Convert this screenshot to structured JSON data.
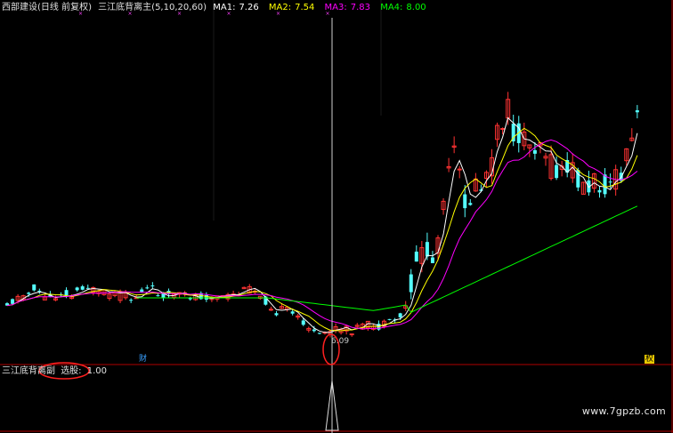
{
  "header": {
    "stock_title": "西部建设(日线 前复权)",
    "indicator_title": "三江底背离主(5,10,20,60)",
    "ma": [
      {
        "label": "MA1:",
        "value": "7.26",
        "color": "#ffffff"
      },
      {
        "label": "MA2:",
        "value": "7.54",
        "color": "#ffff00"
      },
      {
        "label": "MA3:",
        "value": "7.83",
        "color": "#ff00ff"
      },
      {
        "label": "MA4:",
        "value": "8.00",
        "color": "#00ff00"
      }
    ]
  },
  "price_annotation": "6.09",
  "markers": {
    "cai": "财",
    "quan": "权"
  },
  "sub_panel": {
    "title": "三江底背离副",
    "signal_label": "选股:",
    "signal_value": "1.00"
  },
  "watermark": "www.7gpzb.com",
  "colors": {
    "up": "#ff3232",
    "down": "#54ffff",
    "ma1": "#ffffff",
    "ma2": "#ffff00",
    "ma3": "#ff00ff",
    "ma4": "#00ff00",
    "highlight": "#ff2020",
    "axis": "#b00000"
  }
}
